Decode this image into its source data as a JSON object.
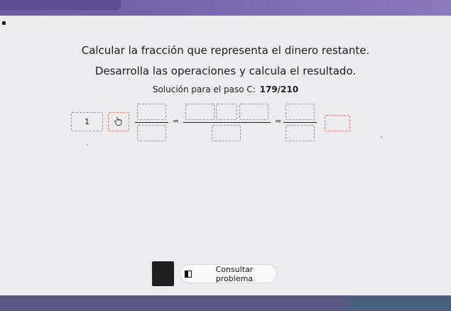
{
  "header": {
    "instruction": "Calcular la fracción que representa el dinero restante.",
    "subinstruction": "Desarrolla las operaciones y calcula el resultado."
  },
  "solution": {
    "label": "Solución para el paso C:",
    "value": "179/210"
  },
  "equation": {
    "first_box_value": "1",
    "equals_symbol": "="
  },
  "actions": {
    "consult_label": "Consultar problema"
  },
  "icons": {
    "hand_cursor": "hand-pointer-icon",
    "book": "book-icon"
  },
  "colors": {
    "top_band": "#6a5a9e",
    "box_border": "#9a9aa0",
    "active_box_border": "#e37878",
    "bottom_band": "#5b5a84"
  }
}
